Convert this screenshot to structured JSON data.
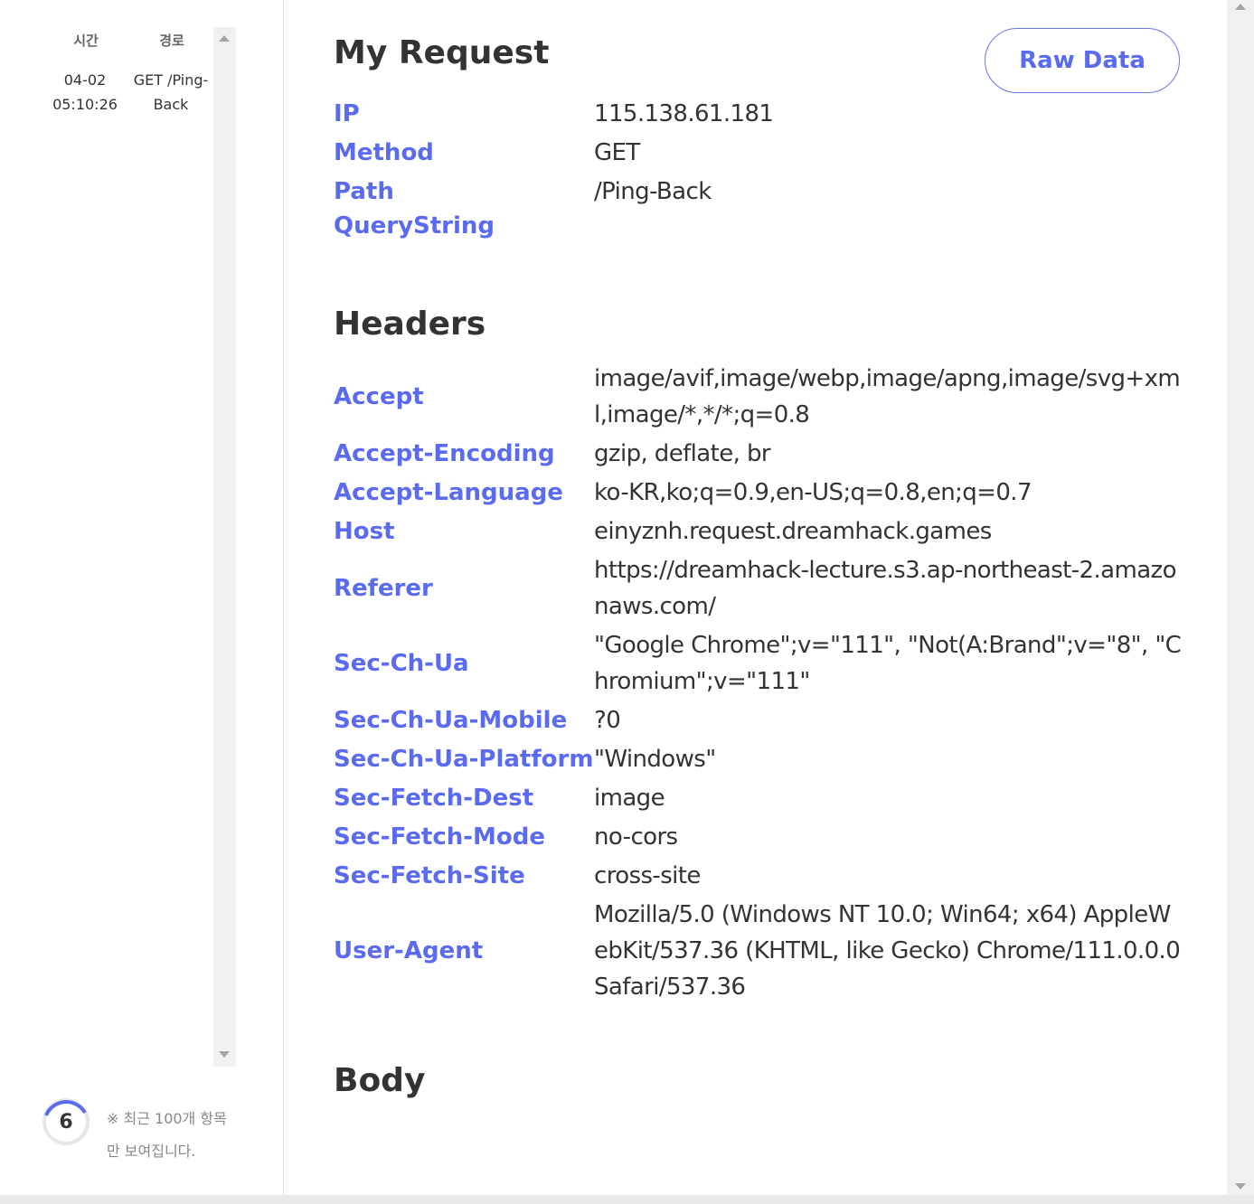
{
  "sidebar": {
    "header": {
      "time": "시간",
      "path": "경로"
    },
    "logs": [
      {
        "time": "04-02 05:10:26",
        "path": "GET /Ping-Back"
      }
    ],
    "counter": "6",
    "notice": "※ 최근 100개 항목만 보여집니다."
  },
  "request": {
    "title": "My Request",
    "raw_button": "Raw Data",
    "fields": [
      {
        "key": "IP",
        "value": "115.138.61.181"
      },
      {
        "key": "Method",
        "value": "GET"
      },
      {
        "key": "Path",
        "value": "/Ping-Back"
      },
      {
        "key": "QueryString",
        "value": ""
      }
    ]
  },
  "headers": {
    "title": "Headers",
    "items": [
      {
        "key": "Accept",
        "value": "image/avif,image/webp,image/apng,image/svg+xml,image/*,*/*;q=0.8"
      },
      {
        "key": "Accept-Encoding",
        "value": "gzip, deflate, br"
      },
      {
        "key": "Accept-Language",
        "value": "ko-KR,ko;q=0.9,en-US;q=0.8,en;q=0.7"
      },
      {
        "key": "Host",
        "value": "einyznh.request.dreamhack.games"
      },
      {
        "key": "Referer",
        "value": "https://dreamhack-lecture.s3.ap-northeast-2.amazonaws.com/"
      },
      {
        "key": "Sec-Ch-Ua",
        "value": "\"Google Chrome\";v=\"111\", \"Not(A:Brand\";v=\"8\", \"Chromium\";v=\"111\""
      },
      {
        "key": "Sec-Ch-Ua-Mobile",
        "value": "?0"
      },
      {
        "key": "Sec-Ch-Ua-Platform",
        "value": "\"Windows\""
      },
      {
        "key": "Sec-Fetch-Dest",
        "value": "image"
      },
      {
        "key": "Sec-Fetch-Mode",
        "value": "no-cors"
      },
      {
        "key": "Sec-Fetch-Site",
        "value": "cross-site"
      },
      {
        "key": "User-Agent",
        "value": "Mozilla/5.0 (Windows NT 10.0; Win64; x64) AppleWebKit/537.36 (KHTML, like Gecko) Chrome/111.0.0.0 Safari/537.36"
      }
    ]
  },
  "body": {
    "title": "Body"
  },
  "colors": {
    "accent": "#5b6bef",
    "text": "#333333",
    "muted": "#888888"
  }
}
